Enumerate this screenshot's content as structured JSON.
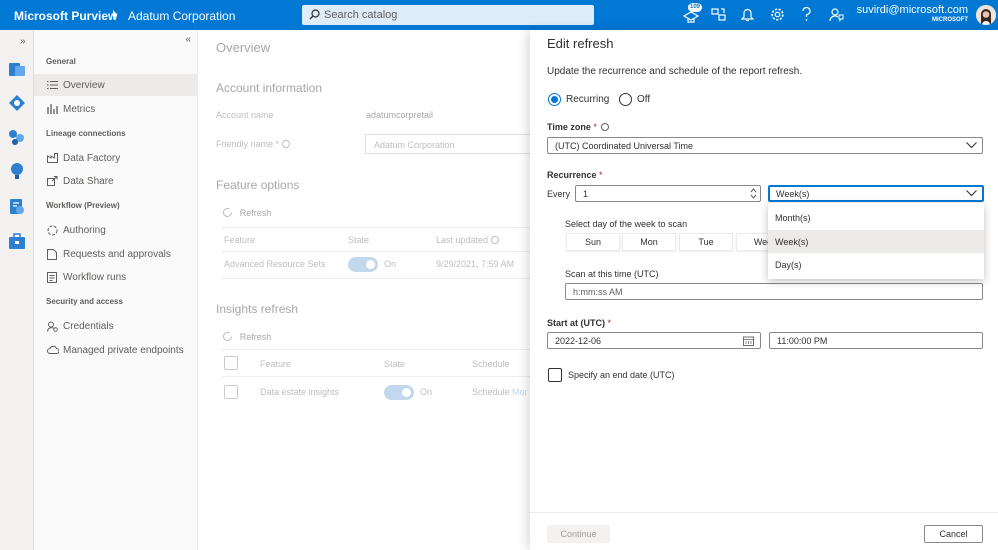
{
  "topbar": {
    "app_name": "Microsoft Purview",
    "tenant": "Adatum Corporation",
    "search_placeholder": "Search catalog",
    "notification_badge": "109",
    "user_email": "suvirdi@microsoft.com",
    "user_org": "MICROSOFT"
  },
  "nav": {
    "sections": {
      "general": "General",
      "lineage": "Lineage connections",
      "workflow": "Workflow (Preview)",
      "security": "Security and access"
    },
    "items": {
      "overview": "Overview",
      "metrics": "Metrics",
      "data_factory": "Data Factory",
      "data_share": "Data Share",
      "authoring": "Authoring",
      "requests": "Requests and approvals",
      "workflow_runs": "Workflow runs",
      "credentials": "Credentials",
      "private_endpoints": "Managed private endpoints"
    }
  },
  "main": {
    "title": "Overview",
    "account_info": {
      "heading": "Account information",
      "account_name_label": "Account name",
      "account_name_value": "adatumcorpretail",
      "friendly_name_label": "Friendly name",
      "friendly_name_value": "Adatum Corporation"
    },
    "feature_options": {
      "heading": "Feature options",
      "refresh_label": "Refresh",
      "columns": {
        "feature": "Feature",
        "state": "State",
        "last_updated": "Last updated"
      },
      "row": {
        "feature": "Advanced Resource Sets",
        "state": "On",
        "last_updated": "9/29/2021, 7:59 AM"
      }
    },
    "insights_refresh": {
      "heading": "Insights refresh",
      "refresh_label": "Refresh",
      "columns": {
        "feature": "Feature",
        "state": "State",
        "schedule": "Schedule"
      },
      "row": {
        "feature": "Data estate insights",
        "state": "On",
        "schedule": "Schedule",
        "schedule_link": "Mor"
      }
    }
  },
  "panel": {
    "title": "Edit refresh",
    "description": "Update the recurrence and schedule of the report refresh.",
    "radio_recurring": "Recurring",
    "radio_off": "Off",
    "timezone_label": "Time zone",
    "timezone_value": "(UTC) Coordinated Universal Time",
    "recurrence_label": "Recurrence",
    "every_label": "Every",
    "every_value": "1",
    "unit_value": "Week(s)",
    "unit_options": [
      "Month(s)",
      "Week(s)",
      "Day(s)"
    ],
    "day_label": "Select day of the week to scan",
    "days": [
      "Sun",
      "Mon",
      "Tue",
      "Wed"
    ],
    "time_label": "Scan at this time (UTC)",
    "time_placeholder": "h:mm:ss AM",
    "start_label": "Start at (UTC)",
    "start_date": "2022-12-06",
    "start_time": "11:00:00 PM",
    "end_date_label": "Specify an end date (UTC)",
    "continue_label": "Continue",
    "cancel_label": "Cancel"
  }
}
